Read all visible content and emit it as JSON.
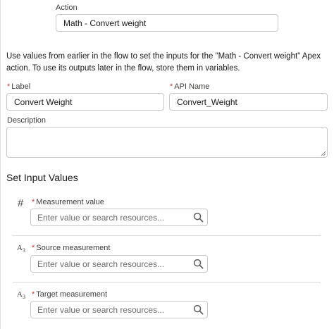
{
  "action": {
    "label": "Action",
    "value": "Math - Convert weight"
  },
  "help_text": "Use values from earlier in the flow to set the inputs for the \"Math - Convert weight\" Apex action. To use its outputs later in the flow, store them in variables.",
  "label_field": {
    "label": "Label",
    "required_mark": "*",
    "value": "Convert Weight"
  },
  "api_name_field": {
    "label": "API Name",
    "required_mark": "*",
    "value": "Convert_Weight"
  },
  "description_field": {
    "label": "Description",
    "value": ""
  },
  "section_title": "Set Input Values",
  "inputs": [
    {
      "type_icon": "#",
      "icon_name": "number-type-icon",
      "label": "Measurement value",
      "required_mark": "*",
      "placeholder": "Enter value or search resources..."
    },
    {
      "type_icon": "A",
      "type_icon_sub": "3",
      "icon_name": "text-type-icon",
      "label": "Source measurement",
      "required_mark": "*",
      "placeholder": "Enter value or search resources..."
    },
    {
      "type_icon": "A",
      "type_icon_sub": "3",
      "icon_name": "text-type-icon",
      "label": "Target measurement",
      "required_mark": "*",
      "placeholder": "Enter value or search resources..."
    }
  ],
  "colors": {
    "required": "#c23934",
    "border": "#c9c9c9",
    "text": "#181818",
    "muted": "#3e3e3c"
  }
}
